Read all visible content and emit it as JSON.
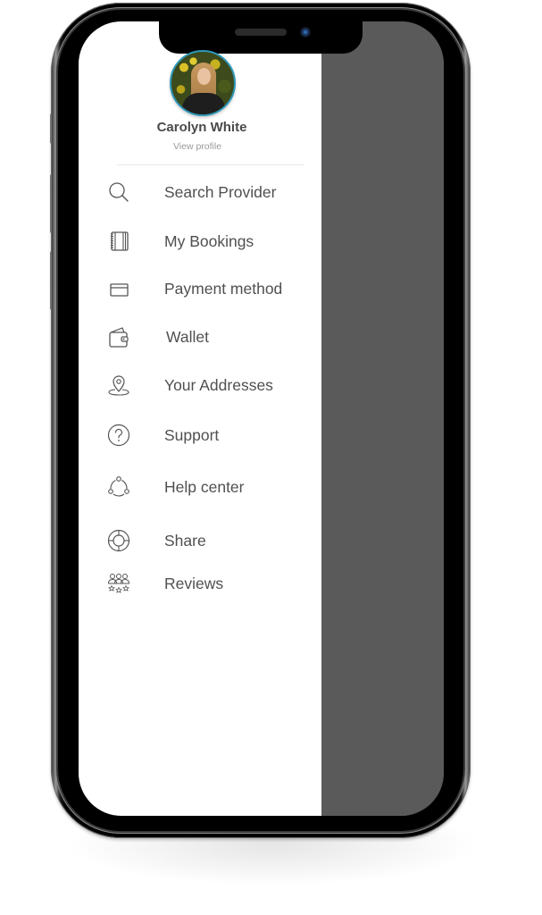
{
  "profile": {
    "name": "Carolyn White",
    "view_profile_label": "View profile",
    "avatar_icon": "user-photo"
  },
  "menu": {
    "items": [
      {
        "label": "Search Provider",
        "icon": "search-icon"
      },
      {
        "label": "My Bookings",
        "icon": "notebook-icon"
      },
      {
        "label": "Payment method",
        "icon": "credit-card-icon"
      },
      {
        "label": "Wallet",
        "icon": "wallet-icon"
      },
      {
        "label": "Your Addresses",
        "icon": "location-pin-icon"
      },
      {
        "label": "Support",
        "icon": "question-circle-icon"
      },
      {
        "label": "Help center",
        "icon": "network-nodes-icon"
      },
      {
        "label": "Share",
        "icon": "lifebuoy-icon"
      },
      {
        "label": "Reviews",
        "icon": "group-rating-icon"
      }
    ]
  },
  "colors": {
    "drawer_bg": "#ffffff",
    "overlay": "#5a5a5a",
    "text": "#505050",
    "avatar_ring": "#2e97b8"
  }
}
